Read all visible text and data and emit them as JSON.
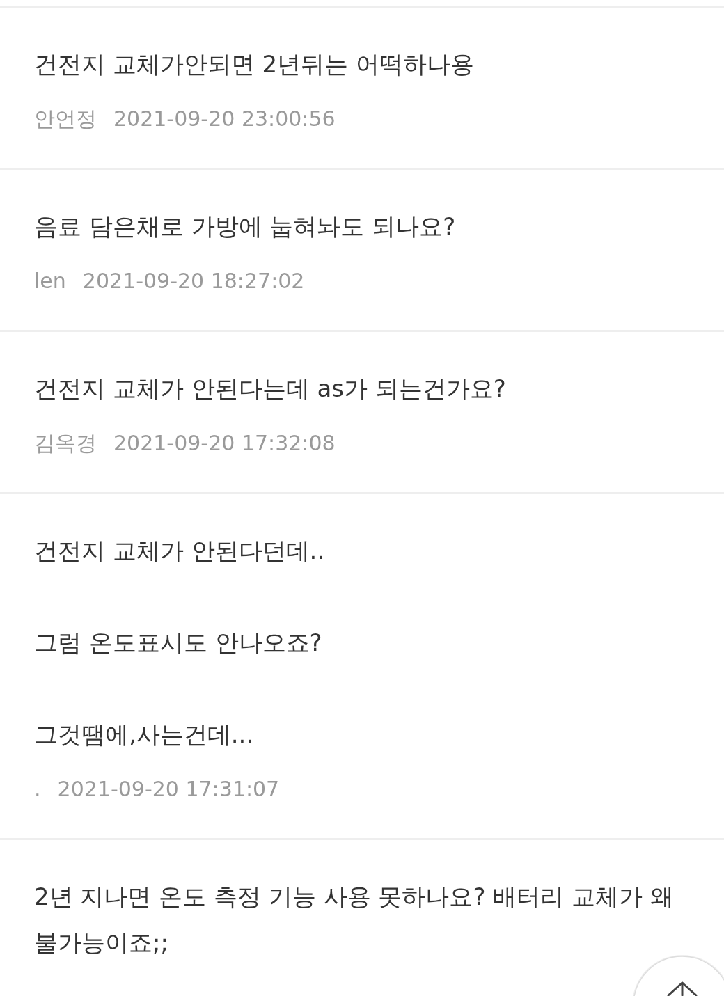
{
  "posts": [
    {
      "title": "건전지 교체가안되면 2년뒤는 어떡하나용",
      "author": "안언정",
      "date": "2021-09-20 23:00:56"
    },
    {
      "title": "음료 담은채로 가방에 눕혀놔도 되나요?",
      "author": "len",
      "date": "2021-09-20 18:27:02"
    },
    {
      "title": "건전지 교체가 안된다는데 as가 되는건가요?",
      "author": "김옥경",
      "date": "2021-09-20 17:32:08"
    },
    {
      "title": "건전지 교체가 안된다던데..\n\n그럼 온도표시도 안나오죠?\n\n그것땜에,사는건데...",
      "author": ".",
      "date": "2021-09-20 17:31:07"
    },
    {
      "title": "2년 지나면 온도 측정 기능 사용 못하나요? 배터리 교체가 왜 불가능이죠;;"
    }
  ]
}
